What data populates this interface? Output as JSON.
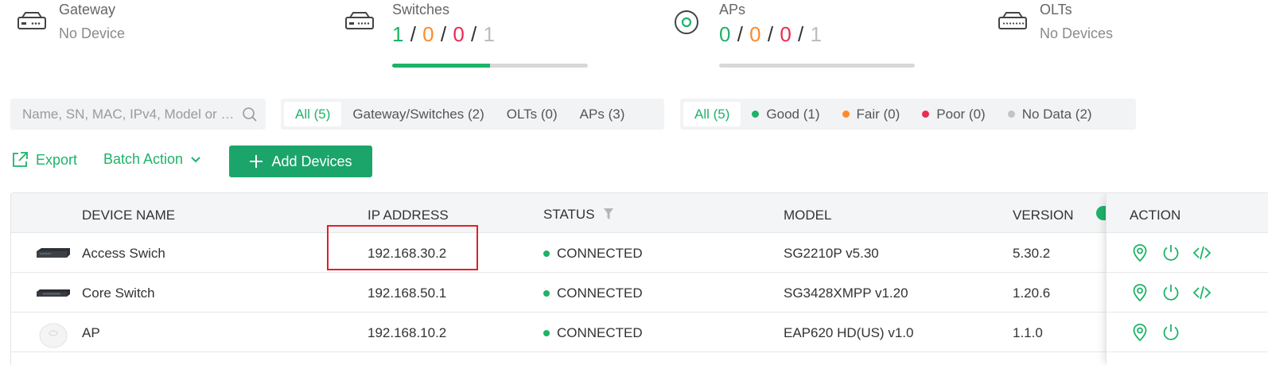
{
  "summary": {
    "gateway": {
      "title": "Gateway",
      "subtitle": "No Device",
      "icon": "gateway-icon"
    },
    "switches": {
      "title": "Switches",
      "counts": [
        "1",
        "0",
        "0",
        "1"
      ],
      "progress": 0.5,
      "icon": "switch-icon"
    },
    "aps": {
      "title": "APs",
      "counts": [
        "0",
        "0",
        "0",
        "1"
      ],
      "progress": 0.0,
      "icon": "ap-icon"
    },
    "olts": {
      "title": "OLTs",
      "subtitle": "No Devices",
      "icon": "olt-icon"
    },
    "separator": "/"
  },
  "search": {
    "placeholder": "Name, SN, MAC, IPv4, Model or La..."
  },
  "type_filter": {
    "items": [
      "All (5)",
      "Gateway/Switches (2)",
      "OLTs (0)",
      "APs (3)"
    ],
    "active": 0
  },
  "health_filter": {
    "items": [
      {
        "label": "All (5)",
        "dot": ""
      },
      {
        "label": "Good (1)",
        "dot": "#1db369"
      },
      {
        "label": "Fair (0)",
        "dot": "#ff8a2b"
      },
      {
        "label": "Poor (0)",
        "dot": "#ea2c52"
      },
      {
        "label": "No Data (2)",
        "dot": "#c4c4c4"
      }
    ],
    "active": 0
  },
  "actions": {
    "export_label": "Export",
    "batch_label": "Batch Action",
    "add_label": "Add Devices"
  },
  "table": {
    "headers": {
      "device_name": "DEVICE NAME",
      "ip": "IP ADDRESS",
      "status": "STATUS",
      "model": "MODEL",
      "version": "VERSION",
      "action": "ACTION"
    },
    "rows": [
      {
        "name": "Access Swich",
        "ip": "192.168.30.2",
        "status": "CONNECTED",
        "model": "SG2210P v5.30",
        "version": "5.30.2",
        "type": "switch",
        "actions": [
          "locate-icon",
          "reboot-icon",
          "cli-icon"
        ]
      },
      {
        "name": "Core Switch",
        "ip": "192.168.50.1",
        "status": "CONNECTED",
        "model": "SG3428XMPP v1.20",
        "version": "1.20.6",
        "type": "switch",
        "actions": [
          "locate-icon",
          "reboot-icon",
          "cli-icon"
        ]
      },
      {
        "name": "AP",
        "ip": "192.168.10.2",
        "status": "CONNECTED",
        "model": "EAP620 HD(US) v1.0",
        "version": "1.1.0",
        "type": "ap",
        "actions": [
          "locate-icon",
          "reboot-icon"
        ]
      }
    ]
  },
  "colors": {
    "accent": "#1db369",
    "button": "#1ca56a",
    "highlight": "#e0202c"
  }
}
